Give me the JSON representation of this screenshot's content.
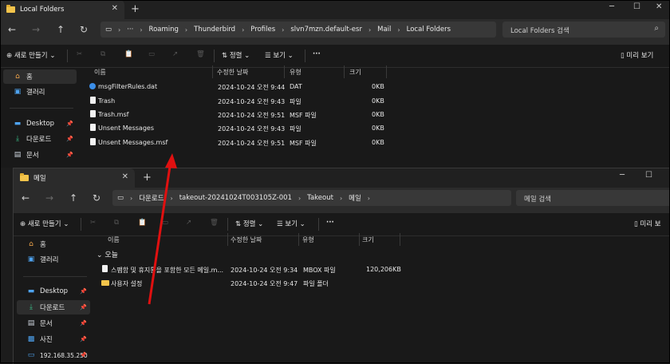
{
  "window1": {
    "tab_title": "Local Folders",
    "breadcrumb": [
      "Roaming",
      "Thunderbird",
      "Profiles",
      "slvn7mzn.default-esr",
      "Mail",
      "Local Folders"
    ],
    "search_placeholder": "Local Folders 검색",
    "toolbar": {
      "new": "새로 만들기",
      "sort": "정렬",
      "view": "보기",
      "preview": "미리 보기"
    },
    "sidebar": [
      {
        "label": "홈",
        "icon": "home-icon"
      },
      {
        "label": "갤러리",
        "icon": "gallery-icon"
      },
      {
        "label": "Desktop",
        "icon": "desktop-icon"
      },
      {
        "label": "다운로드",
        "icon": "download-icon"
      },
      {
        "label": "문서",
        "icon": "document-icon"
      }
    ],
    "columns": [
      "이름",
      "수정한 날짜",
      "유형",
      "크기"
    ],
    "files": [
      {
        "name": "msgFilterRules.dat",
        "date": "2024-10-24 오전 9:44",
        "type": "DAT",
        "size": "0KB",
        "icon": "settings-file-icon"
      },
      {
        "name": "Trash",
        "date": "2024-10-24 오전 9:43",
        "type": "파일",
        "size": "0KB",
        "icon": "file-icon"
      },
      {
        "name": "Trash.msf",
        "date": "2024-10-24 오전 9:51",
        "type": "MSF 파일",
        "size": "0KB",
        "icon": "file-icon"
      },
      {
        "name": "Unsent Messages",
        "date": "2024-10-24 오전 9:43",
        "type": "파일",
        "size": "0KB",
        "icon": "file-icon"
      },
      {
        "name": "Unsent Messages.msf",
        "date": "2024-10-24 오전 9:51",
        "type": "MSF 파일",
        "size": "0KB",
        "icon": "file-icon"
      }
    ]
  },
  "window2": {
    "tab_title": "메일",
    "breadcrumb": [
      "다운로드",
      "takeout-20241024T003105Z-001",
      "Takeout",
      "메일"
    ],
    "search_placeholder": "메일 검색",
    "toolbar": {
      "new": "새로 만들기",
      "sort": "정렬",
      "view": "보기",
      "preview": "미리 보"
    },
    "sidebar": [
      {
        "label": "홈",
        "icon": "home-icon"
      },
      {
        "label": "갤러리",
        "icon": "gallery-icon"
      },
      {
        "label": "Desktop",
        "icon": "desktop-icon"
      },
      {
        "label": "다운로드",
        "icon": "download-icon"
      },
      {
        "label": "문서",
        "icon": "document-icon"
      },
      {
        "label": "사진",
        "icon": "pictures-icon"
      },
      {
        "label": "192.168.35.250",
        "icon": "network-drive-icon"
      }
    ],
    "columns": [
      "이름",
      "수정한 날짜",
      "유형",
      "크기"
    ],
    "group_label": "오늘",
    "files": [
      {
        "name": "스팸함 및 휴지통을 포함한 모든 메일.m...",
        "date": "2024-10-24 오전 9:34",
        "type": "MBOX 파일",
        "size": "120,206KB",
        "icon": "file-icon"
      },
      {
        "name": "사용자 설정",
        "date": "2024-10-24 오전 9:47",
        "type": "파일 폴더",
        "size": "",
        "icon": "folder-icon"
      }
    ]
  },
  "annotation": {
    "arrow_color": "#e01010"
  }
}
